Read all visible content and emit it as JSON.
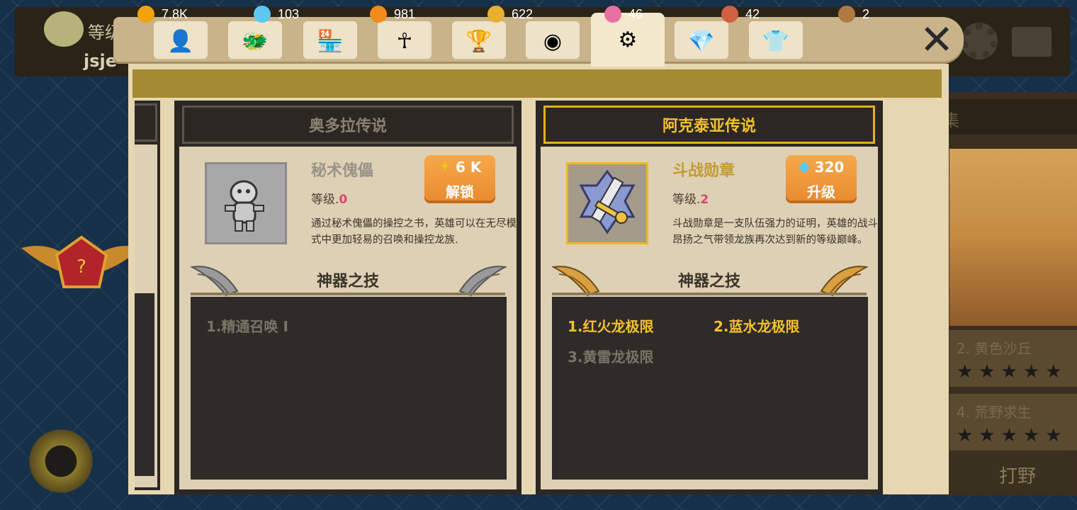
{
  "background": {
    "level_label": "等级",
    "player_name": "jsje",
    "side_rows": [
      {
        "label": "2. 黄色沙丘",
        "stars": "★★★★★"
      },
      {
        "label": "4. 荒野求生",
        "stars": "★★★★★"
      }
    ],
    "side_header": "集",
    "fight_label": "打野"
  },
  "tabs": [
    {
      "icon": "person-icon",
      "glyph": "👤"
    },
    {
      "icon": "dragon-head-icon",
      "glyph": "🐲"
    },
    {
      "icon": "shop-icon",
      "glyph": "🏪"
    },
    {
      "icon": "ankh-icon",
      "glyph": "☥"
    },
    {
      "icon": "trophy-icon",
      "glyph": "🏆"
    },
    {
      "icon": "orb-icon",
      "glyph": "◉"
    },
    {
      "icon": "artifact-icon",
      "glyph": "⚙",
      "active": true
    },
    {
      "icon": "gem-icon",
      "glyph": "💎"
    },
    {
      "icon": "shirt-icon",
      "glyph": "👕"
    }
  ],
  "close_glyph": "✕",
  "resources": [
    {
      "icon": "gold-coin-icon",
      "value": "7.8K",
      "color": "#f2a20c"
    },
    {
      "icon": "diamond-icon",
      "value": "103",
      "color": "#5ec6f0"
    },
    {
      "icon": "fire-orb-icon",
      "value": "981",
      "color": "#f08a1a"
    },
    {
      "icon": "puzzle-gold-icon",
      "value": "622",
      "color": "#e8b030"
    },
    {
      "icon": "puzzle-pink-icon",
      "value": "46",
      "color": "#e870a0"
    },
    {
      "icon": "puzzle-red-icon",
      "value": "42",
      "color": "#d06040"
    },
    {
      "icon": "pet-icon",
      "value": "2",
      "color": "#b07a40"
    }
  ],
  "cards": [
    {
      "header": "奥多拉传说",
      "item_name": "秘术傀儡",
      "level_label": "等级.",
      "level_value": "0",
      "description": "通过秘术傀儡的操控之书，英雄可以在无尽模式中更加轻易的召唤和操控龙族.",
      "cost": "6 K",
      "cost_icon": "puzzle-icon",
      "action": "解锁",
      "skill_title": "神器之技",
      "skills": [
        {
          "label": "1.精通召唤 I",
          "unlocked": false
        }
      ]
    },
    {
      "header": "阿克泰亚传说",
      "item_name": "斗战勋章",
      "level_label": "等级.",
      "level_value": "2",
      "description": "斗战勋章是一支队伍强力的证明，英雄的战斗昂扬之气带领龙族再次达到新的等级巅峰。",
      "cost": "320",
      "cost_icon": "diamond-icon",
      "action": "升级",
      "skill_title": "神器之技",
      "skills": [
        {
          "label": "1.红火龙极限",
          "unlocked": true
        },
        {
          "label": "2.蓝水龙极限",
          "unlocked": true
        },
        {
          "label": "3.黄雷龙极限",
          "unlocked": false
        }
      ]
    }
  ]
}
